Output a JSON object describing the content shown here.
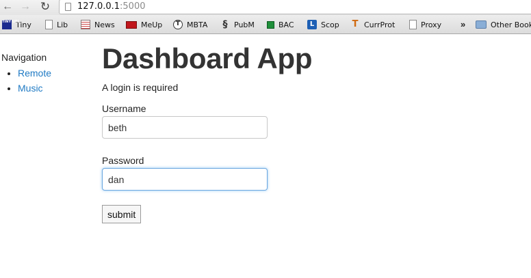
{
  "browser": {
    "url_host": "127.0.0.1",
    "url_port": ":5000",
    "bookmarks": [
      {
        "label": "Tiny",
        "icon": "tinyurl-icon",
        "icon_text": "TINY URL"
      },
      {
        "label": "Lib",
        "icon": "page-icon"
      },
      {
        "label": "News",
        "icon": "news-icon"
      },
      {
        "label": "MeUp",
        "icon": "meup-icon"
      },
      {
        "label": "MBTA",
        "icon": "mbta-icon",
        "icon_text": "T"
      },
      {
        "label": "PubM",
        "icon": "pubmed-icon",
        "icon_text": "§"
      },
      {
        "label": "BAC",
        "icon": "bac-icon"
      },
      {
        "label": "Scop",
        "icon": "scopus-icon",
        "icon_text": "L"
      },
      {
        "label": "CurrProt",
        "icon": "currprot-icon",
        "icon_text": "T"
      },
      {
        "label": "Proxy",
        "icon": "page-icon"
      }
    ],
    "overflow_label": "»",
    "other_bookmarks_label": "Other Bookmarks"
  },
  "sidebar": {
    "heading": "Navigation",
    "items": [
      {
        "label": "Remote"
      },
      {
        "label": "Music"
      }
    ]
  },
  "main": {
    "title": "Dashboard App",
    "notice": "A login is required",
    "username_label": "Username",
    "username_value": "beth",
    "password_label": "Password",
    "password_value": "dan",
    "submit_label": "submit"
  },
  "colors": {
    "link": "#1f7ac4",
    "focus_ring": "#6aa6e0",
    "title": "#333333"
  }
}
